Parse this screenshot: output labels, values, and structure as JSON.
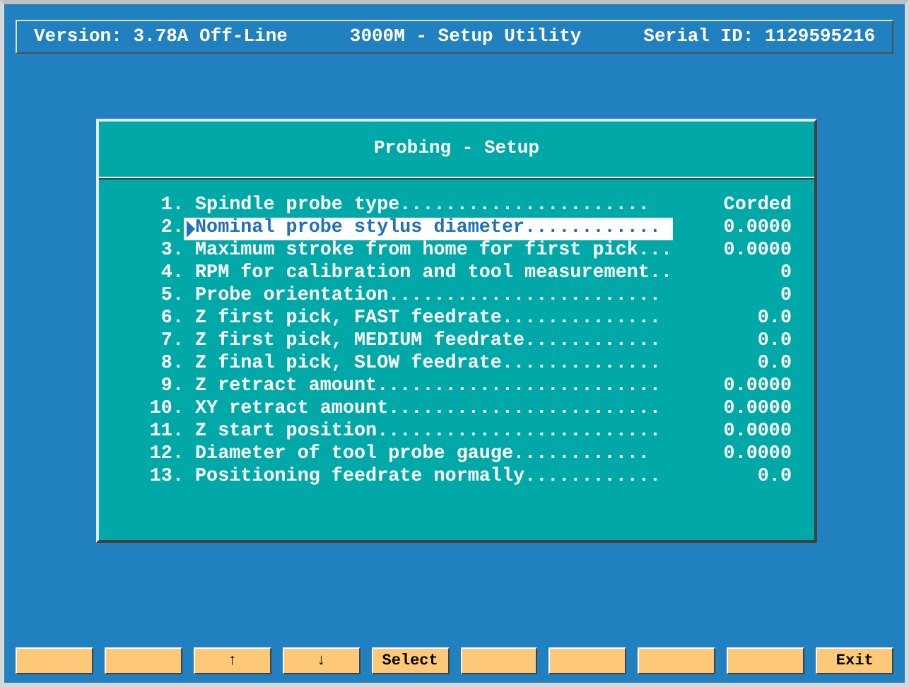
{
  "header": {
    "version": "Version: 3.78A Off-Line",
    "title": "3000M - Setup Utility",
    "serial": "Serial ID: 1129595216"
  },
  "dialog": {
    "title": "Probing - Setup",
    "rows": [
      {
        "number": "1.",
        "label": "Spindle probe type......................",
        "value": "Corded",
        "selected": false
      },
      {
        "number": "2.",
        "label": "Nominal probe stylus diameter............",
        "value": "0.0000",
        "selected": true
      },
      {
        "number": "3.",
        "label": "Maximum stroke from home for first pick...",
        "value": "0.0000",
        "selected": false
      },
      {
        "number": "4.",
        "label": "RPM for calibration and tool measurement..",
        "value": "0",
        "selected": false
      },
      {
        "number": "5.",
        "label": "Probe orientation........................",
        "value": "0",
        "selected": false
      },
      {
        "number": "6.",
        "label": "Z first pick, FAST feedrate..............",
        "value": "0.0",
        "selected": false
      },
      {
        "number": "7.",
        "label": "Z first pick, MEDIUM feedrate............",
        "value": "0.0",
        "selected": false
      },
      {
        "number": "8.",
        "label": "Z final pick, SLOW feedrate..............",
        "value": "0.0",
        "selected": false
      },
      {
        "number": "9.",
        "label": "Z retract amount.........................",
        "value": "0.0000",
        "selected": false
      },
      {
        "number": "10.",
        "label": "XY retract amount........................",
        "value": "0.0000",
        "selected": false
      },
      {
        "number": "11.",
        "label": "Z start position.........................",
        "value": "0.0000",
        "selected": false
      },
      {
        "number": "12.",
        "label": "Diameter of tool probe gauge............",
        "value": "0.0000",
        "selected": false
      },
      {
        "number": "13.",
        "label": "Positioning feedrate normally............",
        "value": "0.0",
        "selected": false
      }
    ]
  },
  "function_keys": [
    {
      "kind": "blank"
    },
    {
      "kind": "blank"
    },
    {
      "kind": "key",
      "label": "↑"
    },
    {
      "kind": "key",
      "label": "↓"
    },
    {
      "kind": "key",
      "label": "Select"
    },
    {
      "kind": "blank"
    },
    {
      "kind": "blank"
    },
    {
      "kind": "blank"
    },
    {
      "kind": "blank"
    },
    {
      "kind": "key",
      "label": "Exit"
    }
  ]
}
